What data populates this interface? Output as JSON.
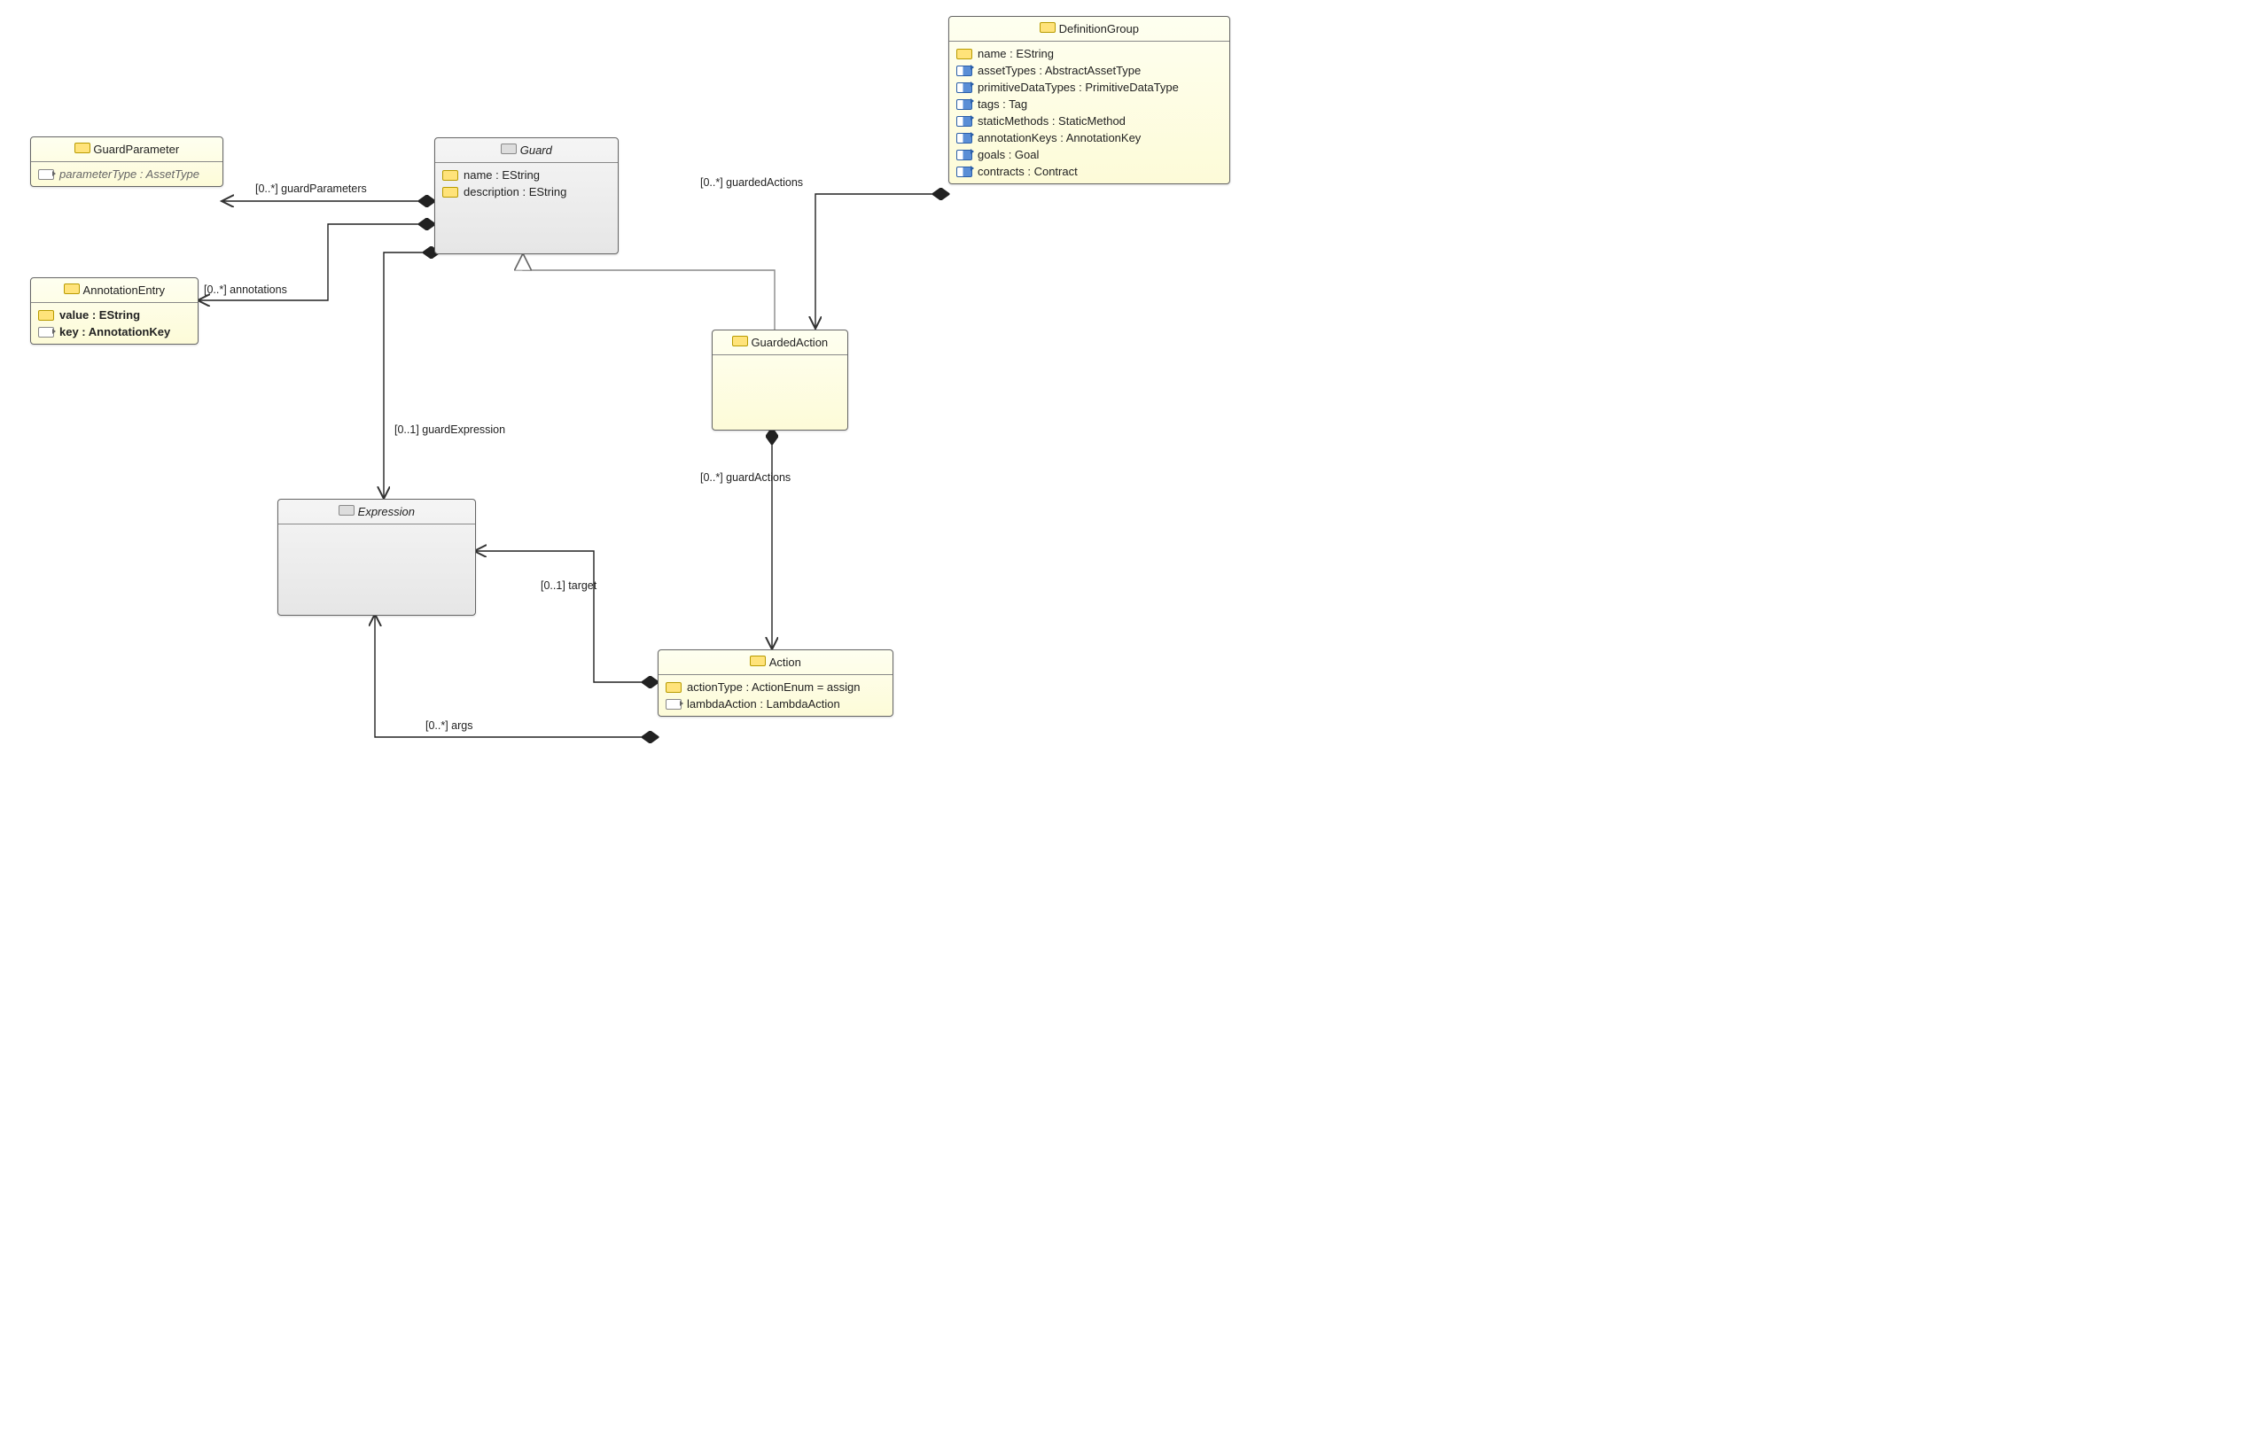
{
  "classes": {
    "GuardParameter": {
      "title": "GuardParameter",
      "attrs": {
        "parameterType": "parameterType : AssetType"
      }
    },
    "AnnotationEntry": {
      "title": "AnnotationEntry",
      "attrs": {
        "value": "value : EString",
        "key": "key : AnnotationKey"
      }
    },
    "Guard": {
      "title": "Guard",
      "attrs": {
        "name": "name : EString",
        "description": "description : EString"
      }
    },
    "Expression": {
      "title": "Expression"
    },
    "DefinitionGroup": {
      "title": "DefinitionGroup",
      "attrs": {
        "name": "name : EString",
        "assetTypes": "assetTypes : AbstractAssetType",
        "primitiveDataTypes": "primitiveDataTypes : PrimitiveDataType",
        "tags": "tags : Tag",
        "staticMethods": "staticMethods : StaticMethod",
        "annotationKeys": "annotationKeys : AnnotationKey",
        "goals": "goals : Goal",
        "contracts": "contracts : Contract"
      }
    },
    "GuardedAction": {
      "title": "GuardedAction"
    },
    "Action": {
      "title": "Action",
      "attrs": {
        "actionType": "actionType : ActionEnum = assign",
        "lambdaAction": "lambdaAction : LambdaAction"
      }
    }
  },
  "labels": {
    "guardParameters": "[0..*] guardParameters",
    "annotations": "[0..*] annotations",
    "guardExpression": "[0..1] guardExpression",
    "guardedActions": "[0..*] guardedActions",
    "guardActions": "[0..*] guardActions",
    "target": "[0..1] target",
    "args": "[0..*] args"
  }
}
